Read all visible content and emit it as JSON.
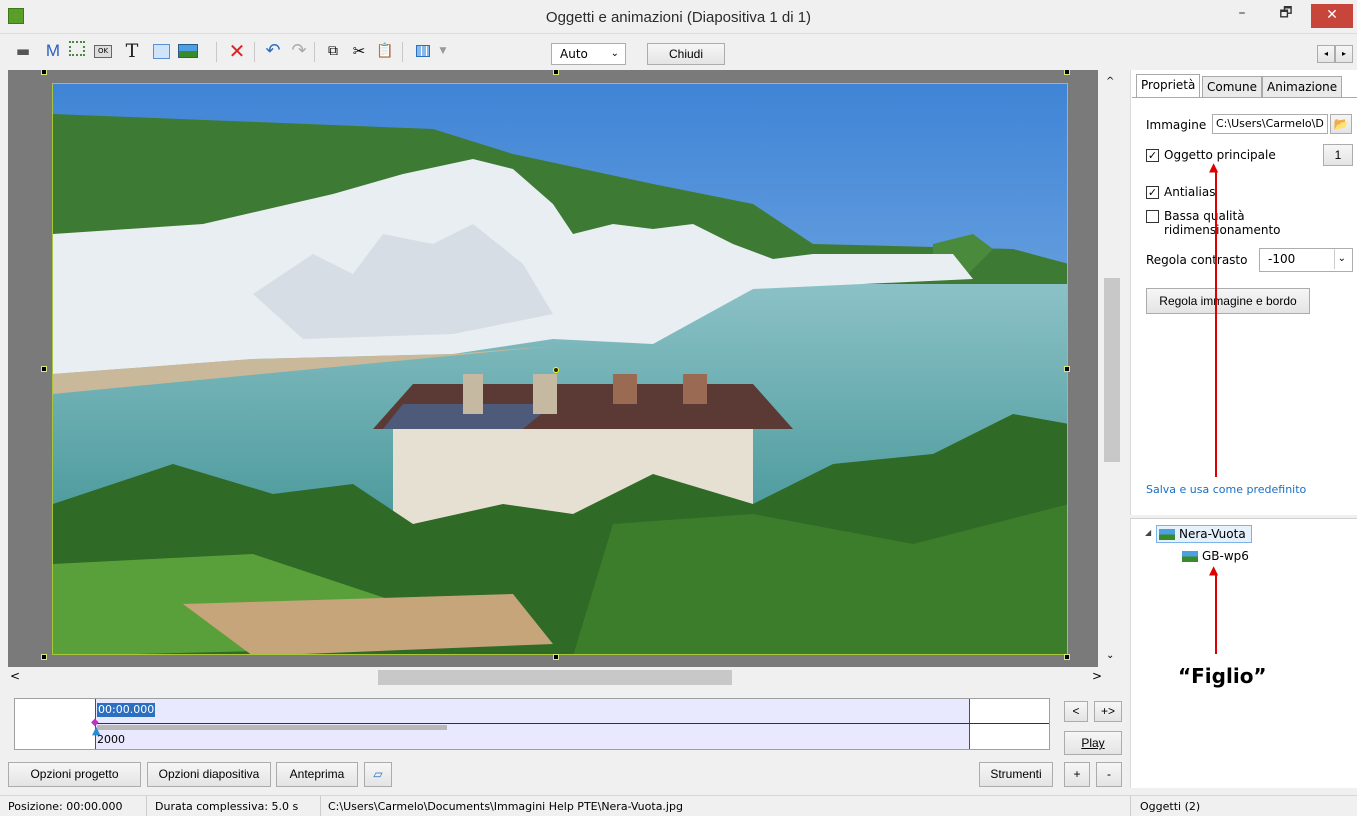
{
  "window": {
    "title": "Oggetti e animazioni  (Diapositiva 1 di 1)",
    "minimize": "–",
    "maximize": "🗗",
    "close": "✕"
  },
  "toolbar": {
    "m_label": "M",
    "t_label": "T",
    "ok_label": "OK",
    "zoom_value": "Auto",
    "close_label": "Chiudi"
  },
  "timeline": {
    "position": "00:00.000",
    "duration_ms": "2000",
    "prev_label": "<",
    "next_label": "+>",
    "play_label": "Play"
  },
  "bottom_buttons": {
    "project_options": "Opzioni progetto",
    "slide_options": "Opzioni diapositiva",
    "preview": "Anteprima",
    "tools": "Strumenti",
    "plus": "+",
    "minus": "-"
  },
  "tabs": {
    "properties": "Proprietà",
    "common": "Comune",
    "animation": "Animazione"
  },
  "properties": {
    "image_label": "Immagine",
    "image_path": "C:\\Users\\Carmelo\\D",
    "main_object_label": "Oggetto principale",
    "main_object_checked": true,
    "main_object_index": "1",
    "antialias_label": "Antialias",
    "antialias_checked": true,
    "low_quality_label": "Bassa qualità ridimensionamento",
    "low_quality_checked": false,
    "contrast_label": "Regola contrasto",
    "contrast_value": "-100",
    "adjust_button": "Regola immagine e bordo",
    "save_default_link": "Salva e usa come predefinito"
  },
  "tree": {
    "parent": "Nera-Vuota",
    "child": "GB-wp6",
    "annotation": "“Figlio”"
  },
  "statusbar": {
    "position": "Posizione:  00:00.000",
    "duration": "Durata complessiva:  5.0 s",
    "path": "C:\\Users\\Carmelo\\Documents\\Immagini Help PTE\\Nera-Vuota.jpg",
    "objects": "Oggetti (2)"
  },
  "colors": {
    "accent_link": "#1a6fc0",
    "annotation_red": "#dd0000",
    "selection_border": "#a8c63a",
    "timeline_fill": "#e8e8ff",
    "close_red": "#c7453a"
  }
}
